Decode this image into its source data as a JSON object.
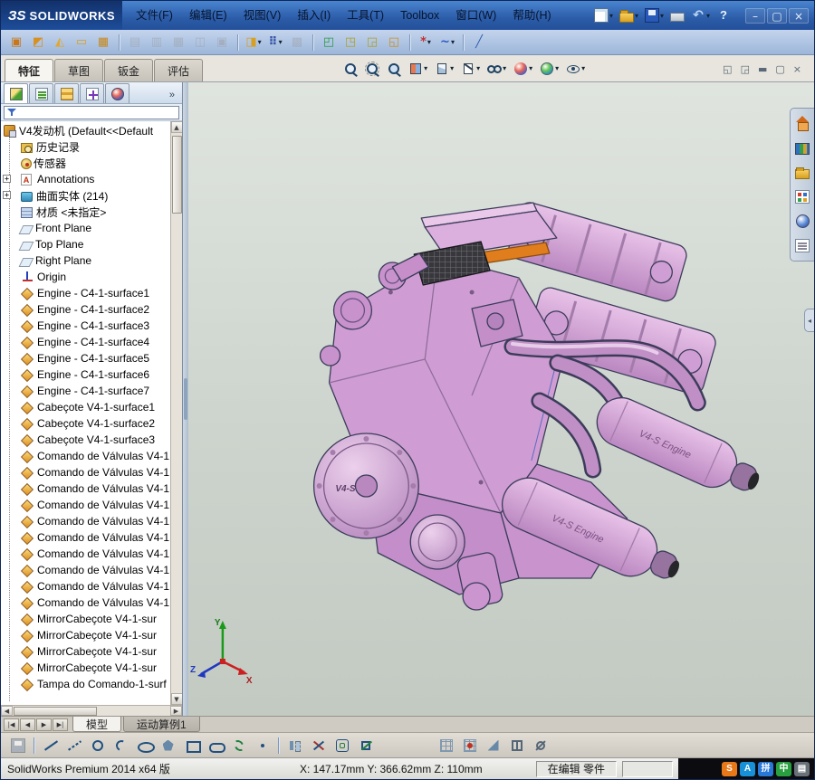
{
  "titlebar": {
    "logo_ds": "ЗS",
    "logo_text": "SOLIDWORKS",
    "menus": [
      "文件(F)",
      "编辑(E)",
      "视图(V)",
      "插入(I)",
      "工具(T)",
      "Toolbox",
      "窗口(W)",
      "帮助(H)"
    ],
    "quick_tools": [
      {
        "name": "new-document",
        "glyph": "",
        "dropdown": true
      },
      {
        "name": "open",
        "glyph": "",
        "dropdown": true
      },
      {
        "name": "save",
        "glyph": "",
        "dropdown": true
      },
      {
        "name": "print",
        "glyph": "",
        "dropdown": false
      },
      {
        "name": "undo",
        "glyph": "↶",
        "dropdown": true
      },
      {
        "name": "help",
        "glyph": "?",
        "dropdown": false
      }
    ],
    "window_buttons": [
      {
        "name": "minimize",
        "glyph": "–"
      },
      {
        "name": "restore",
        "glyph": "▢"
      },
      {
        "name": "close",
        "glyph": "×"
      }
    ]
  },
  "toolbar2": [
    {
      "name": "capture",
      "glyph": "▣",
      "color": "#c8781a"
    },
    {
      "name": "publish",
      "glyph": "◩",
      "color": "#d89020"
    },
    {
      "name": "alert",
      "glyph": "◭",
      "color": "#e0a830"
    },
    {
      "name": "mail",
      "glyph": "▭",
      "color": "#d8a020"
    },
    {
      "name": "grid-view",
      "glyph": "▦",
      "color": "#c88818"
    },
    {
      "gap": true
    },
    {
      "name": "doc-tool-1",
      "glyph": "▤",
      "color": "#9098a4",
      "disabled": true
    },
    {
      "name": "doc-tool-2",
      "glyph": "▥",
      "color": "#9098a4",
      "disabled": true
    },
    {
      "name": "doc-tool-3",
      "glyph": "▦",
      "color": "#9098a4",
      "disabled": true
    },
    {
      "name": "doc-tool-4",
      "glyph": "◫",
      "color": "#9098a4",
      "disabled": true
    },
    {
      "name": "doc-tool-5",
      "glyph": "▣",
      "color": "#9098a4",
      "disabled": true
    },
    {
      "gap": true
    },
    {
      "name": "palette",
      "glyph": "◨",
      "color": "#d8a020",
      "dropdown": true
    },
    {
      "name": "quick-snaps",
      "glyph": "⠿",
      "color": "#3858a8",
      "dropdown": true
    },
    {
      "name": "grid-options",
      "glyph": "▩",
      "color": "#9098a4",
      "disabled": true
    },
    {
      "gap": true
    },
    {
      "name": "green-box",
      "glyph": "◰",
      "color": "#2a9a40"
    },
    {
      "name": "tools-box-1",
      "glyph": "◳",
      "color": "#b0a020"
    },
    {
      "name": "tools-box-2",
      "glyph": "◲",
      "color": "#b0a020"
    },
    {
      "name": "gold-box",
      "glyph": "◱",
      "color": "#d09020"
    },
    {
      "gap": true
    },
    {
      "name": "star-tool",
      "glyph": "*",
      "color": "#c03030",
      "dropdown": true
    },
    {
      "name": "curve-tool",
      "glyph": "~",
      "color": "#2858c8",
      "dropdown": true
    },
    {
      "gap": true
    },
    {
      "name": "pen-tool",
      "glyph": "╱",
      "color": "#3060b0"
    }
  ],
  "ribbon_tabs": {
    "tabs": [
      "特征",
      "草图",
      "钣金",
      "评估"
    ],
    "active": 0
  },
  "headsup": [
    {
      "name": "zoom-fit"
    },
    {
      "name": "zoom-area"
    },
    {
      "name": "zoom-previous"
    },
    {
      "name": "section-view",
      "dropdown": true
    },
    {
      "name": "view-orientation",
      "dropdown": true
    },
    {
      "name": "display-style",
      "dropdown": true
    },
    {
      "name": "hide-show",
      "dropdown": true
    },
    {
      "name": "edit-appearance",
      "dropdown": true
    },
    {
      "name": "apply-scene",
      "dropdown": true
    },
    {
      "name": "view-settings",
      "dropdown": true
    }
  ],
  "doc_window_buttons": [
    {
      "name": "previous-window",
      "glyph": "◱"
    },
    {
      "name": "next-window",
      "glyph": "◲"
    },
    {
      "name": "minimize-document",
      "glyph": "▬"
    },
    {
      "name": "restore-document",
      "glyph": "▢"
    },
    {
      "name": "close-document",
      "glyph": "×"
    }
  ],
  "left_panel": {
    "manager_tabs": [
      "featuremanager",
      "propertymanager",
      "configurationmanager",
      "dimxpertmanager",
      "displaymanager"
    ],
    "overflow": "»",
    "tree": {
      "root": {
        "label": "V4发动机  (Default<<Default"
      },
      "items": [
        {
          "icon": "history",
          "label": "历史记录"
        },
        {
          "icon": "sensors",
          "label": "传感器"
        },
        {
          "icon": "annotations",
          "label": "Annotations",
          "expand": "+"
        },
        {
          "icon": "surface-folder",
          "label": "曲面实体 (214)",
          "expand": "+"
        },
        {
          "icon": "material",
          "label": "材质 <未指定>"
        },
        {
          "icon": "plane",
          "label": "Front Plane"
        },
        {
          "icon": "plane",
          "label": "Top Plane"
        },
        {
          "icon": "plane",
          "label": "Right Plane"
        },
        {
          "icon": "origin",
          "label": "Origin"
        },
        {
          "icon": "surface",
          "label": "Engine - C4-1-surface1"
        },
        {
          "icon": "surface",
          "label": "Engine - C4-1-surface2"
        },
        {
          "icon": "surface",
          "label": "Engine - C4-1-surface3"
        },
        {
          "icon": "surface",
          "label": "Engine - C4-1-surface4"
        },
        {
          "icon": "surface",
          "label": "Engine - C4-1-surface5"
        },
        {
          "icon": "surface",
          "label": "Engine - C4-1-surface6"
        },
        {
          "icon": "surface",
          "label": "Engine - C4-1-surface7"
        },
        {
          "icon": "surface",
          "label": "Cabeçote V4-1-surface1"
        },
        {
          "icon": "surface",
          "label": "Cabeçote V4-1-surface2"
        },
        {
          "icon": "surface",
          "label": "Cabeçote V4-1-surface3"
        },
        {
          "icon": "surface",
          "label": "Comando de Válvulas V4-1"
        },
        {
          "icon": "surface",
          "label": "Comando de Válvulas V4-1"
        },
        {
          "icon": "surface",
          "label": "Comando de Válvulas V4-1"
        },
        {
          "icon": "surface",
          "label": "Comando de Válvulas V4-1"
        },
        {
          "icon": "surface",
          "label": "Comando de Válvulas V4-1"
        },
        {
          "icon": "surface",
          "label": "Comando de Válvulas V4-1"
        },
        {
          "icon": "surface",
          "label": "Comando de Válvulas V4-1"
        },
        {
          "icon": "surface",
          "label": "Comando de Válvulas V4-1"
        },
        {
          "icon": "surface",
          "label": "Comando de Válvulas V4-1"
        },
        {
          "icon": "surface",
          "label": "Comando de Válvulas V4-1"
        },
        {
          "icon": "surface",
          "label": "MirrorCabeçote V4-1-sur"
        },
        {
          "icon": "surface",
          "label": "MirrorCabeçote V4-1-sur"
        },
        {
          "icon": "surface",
          "label": "MirrorCabeçote V4-1-sur"
        },
        {
          "icon": "surface",
          "label": "MirrorCabeçote V4-1-sur"
        },
        {
          "icon": "surface",
          "label": "Tampa do Comando-1-surf"
        }
      ]
    }
  },
  "viewport": {
    "labels": {
      "clutch_cover": "V4-S",
      "muffler": "V4-S Engine"
    },
    "triad": {
      "x": "X",
      "y": "Y",
      "z": "Z"
    }
  },
  "task_pane": [
    "solidworks-resources",
    "design-library",
    "file-explorer",
    "view-palette",
    "appearances-scenes",
    "custom-properties"
  ],
  "task_pane_collapse": "◂",
  "bottom_tabs": {
    "nav": [
      "|◀",
      "◀",
      "▶",
      "▶|"
    ],
    "tabs": [
      "模型",
      "运动算例1"
    ],
    "active": 0
  },
  "sketch_toolbar": {
    "left": [
      "save",
      "|",
      "line",
      "centerline",
      "circle",
      "arc",
      "ellipse",
      "polygon",
      "rectangle",
      "slot",
      "spline",
      "point",
      "|",
      "mirror",
      "trim",
      "offset",
      "convert"
    ],
    "right": [
      "grid",
      "snap",
      "angle",
      "viewgrid",
      "settings"
    ]
  },
  "statusbar": {
    "product": "SolidWorks Premium 2014 x64 版",
    "coordinates": "X: 147.17mm Y: 366.62mm Z: 110mm",
    "edit_mode": "在编辑 零件",
    "tray": [
      {
        "glyph": "S",
        "color": "#e87818"
      },
      {
        "glyph": "A",
        "color": "#1890d8"
      },
      {
        "glyph": "拼",
        "color": "#2878d8"
      },
      {
        "glyph": "中",
        "color": "#28a040"
      },
      {
        "glyph": "▤",
        "color": "#687078"
      }
    ]
  }
}
